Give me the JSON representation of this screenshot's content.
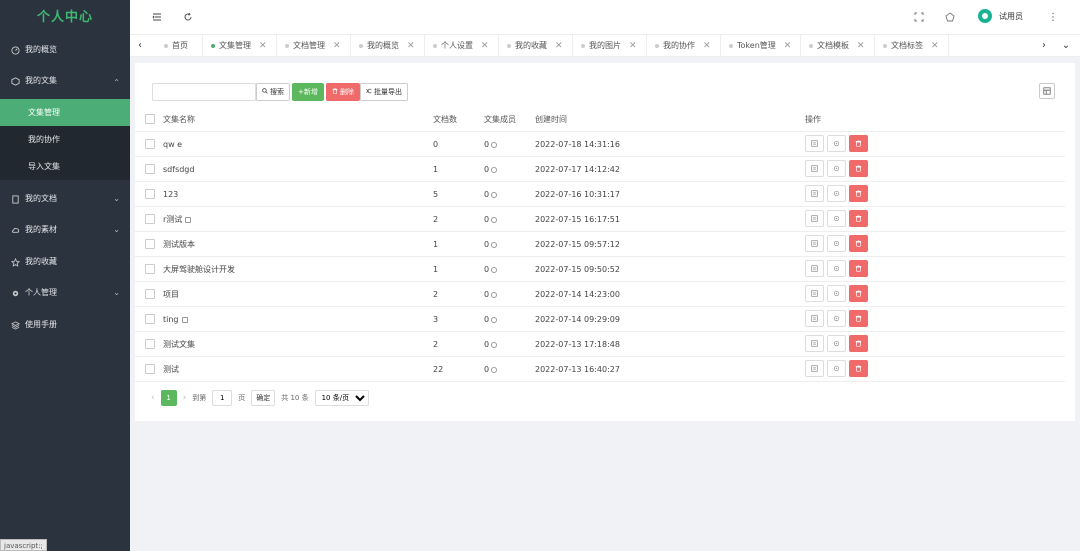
{
  "sidebar": {
    "title": "个人中心",
    "items": [
      {
        "label": "我的概览",
        "icon": "dashboard-icon"
      },
      {
        "label": "我的文集",
        "icon": "box-icon",
        "arrow": "^"
      },
      {
        "label": "我的文档",
        "icon": "doc-icon",
        "arrow": "v"
      },
      {
        "label": "我的素材",
        "icon": "cloud-icon",
        "arrow": "v"
      },
      {
        "label": "我的收藏",
        "icon": "star-icon"
      },
      {
        "label": "个人管理",
        "icon": "gear-icon",
        "arrow": "v"
      },
      {
        "label": "使用手册",
        "icon": "layers-icon"
      }
    ],
    "subitems": [
      "文集管理",
      "我的协作",
      "导入文集"
    ],
    "status_text": "javascript:;"
  },
  "topbar": {
    "user_name": "试用员"
  },
  "tabs": [
    "首页",
    "文集管理",
    "文档管理",
    "我的概览",
    "个人设置",
    "我的收藏",
    "我的图片",
    "我的协作",
    "Token管理",
    "文档模板",
    "文档标签"
  ],
  "toolbar": {
    "search_placeholder": "",
    "search_label": "搜索",
    "add_label": "+新增",
    "delete_label": "删除",
    "export_label": "批量导出"
  },
  "table": {
    "headers": [
      "文集名称",
      "文档数",
      "文集成员",
      "创建时间",
      "操作"
    ],
    "rows": [
      {
        "name": "qw e",
        "docs": "0",
        "members": "0",
        "created": "2022-07-18 14:31:16",
        "locked": false
      },
      {
        "name": "sdfsdgd",
        "docs": "1",
        "members": "0",
        "created": "2022-07-17 14:12:42",
        "locked": false
      },
      {
        "name": "123",
        "docs": "5",
        "members": "0",
        "created": "2022-07-16 10:31:17",
        "locked": false
      },
      {
        "name": "r测试",
        "docs": "2",
        "members": "0",
        "created": "2022-07-15 16:17:51",
        "locked": true
      },
      {
        "name": "测试版本",
        "docs": "1",
        "members": "0",
        "created": "2022-07-15 09:57:12",
        "locked": false
      },
      {
        "name": "大屏驾驶舱设计开发",
        "docs": "1",
        "members": "0",
        "created": "2022-07-15 09:50:52",
        "locked": false
      },
      {
        "name": "项目",
        "docs": "2",
        "members": "0",
        "created": "2022-07-14 14:23:00",
        "locked": false
      },
      {
        "name": "ting",
        "docs": "3",
        "members": "0",
        "created": "2022-07-14 09:29:09",
        "locked": true
      },
      {
        "name": "测试文集",
        "docs": "2",
        "members": "0",
        "created": "2022-07-13 17:18:48",
        "locked": false
      },
      {
        "name": "测试",
        "docs": "22",
        "members": "0",
        "created": "2022-07-13 16:40:27",
        "locked": false
      }
    ]
  },
  "pager": {
    "current_page": "1",
    "goto_label": "到第",
    "goto_value": "1",
    "page_unit": "页",
    "confirm_label": "确定",
    "total_label": "共 10 条",
    "page_size_label": "10 条/页"
  }
}
